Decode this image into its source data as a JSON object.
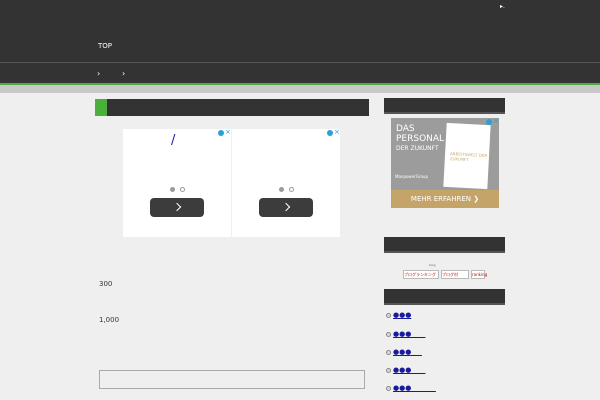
{
  "header": {
    "mark": "▸.",
    "top_link": "TOP"
  },
  "nav": {
    "items": [
      "›",
      "›"
    ]
  },
  "main": {
    "ads": [
      {
        "slash": "/"
      },
      {
        "slash": ""
      }
    ],
    "text_300": "300",
    "text_1000": "1,000"
  },
  "sidebar": {
    "banner": {
      "line1": "DAS",
      "line2": "PERSONAL",
      "line3": "DER ZUKUNFT",
      "logo": "ManpowerGroup",
      "card_text": "ARBEITSWELT DER ZUKUNFT",
      "cta": "MEHR ERFAHREN ❯"
    },
    "ranking": {
      "caption": "blog",
      "badges": [
        "ブログランキング",
        "ブログ村",
        "ranking"
      ]
    },
    "links": [
      "●●●",
      "●●●____",
      "●●●___",
      "●●●____",
      "●●●_______"
    ]
  },
  "colors": {
    "header_bg": "#333333",
    "accent": "#4cae3c",
    "page_bg": "#efefef",
    "link": "#1a1aa0"
  },
  "icons": {
    "ad_info": "info-icon",
    "ad_close": "close-icon",
    "carousel_next": "chevron-right-icon"
  }
}
